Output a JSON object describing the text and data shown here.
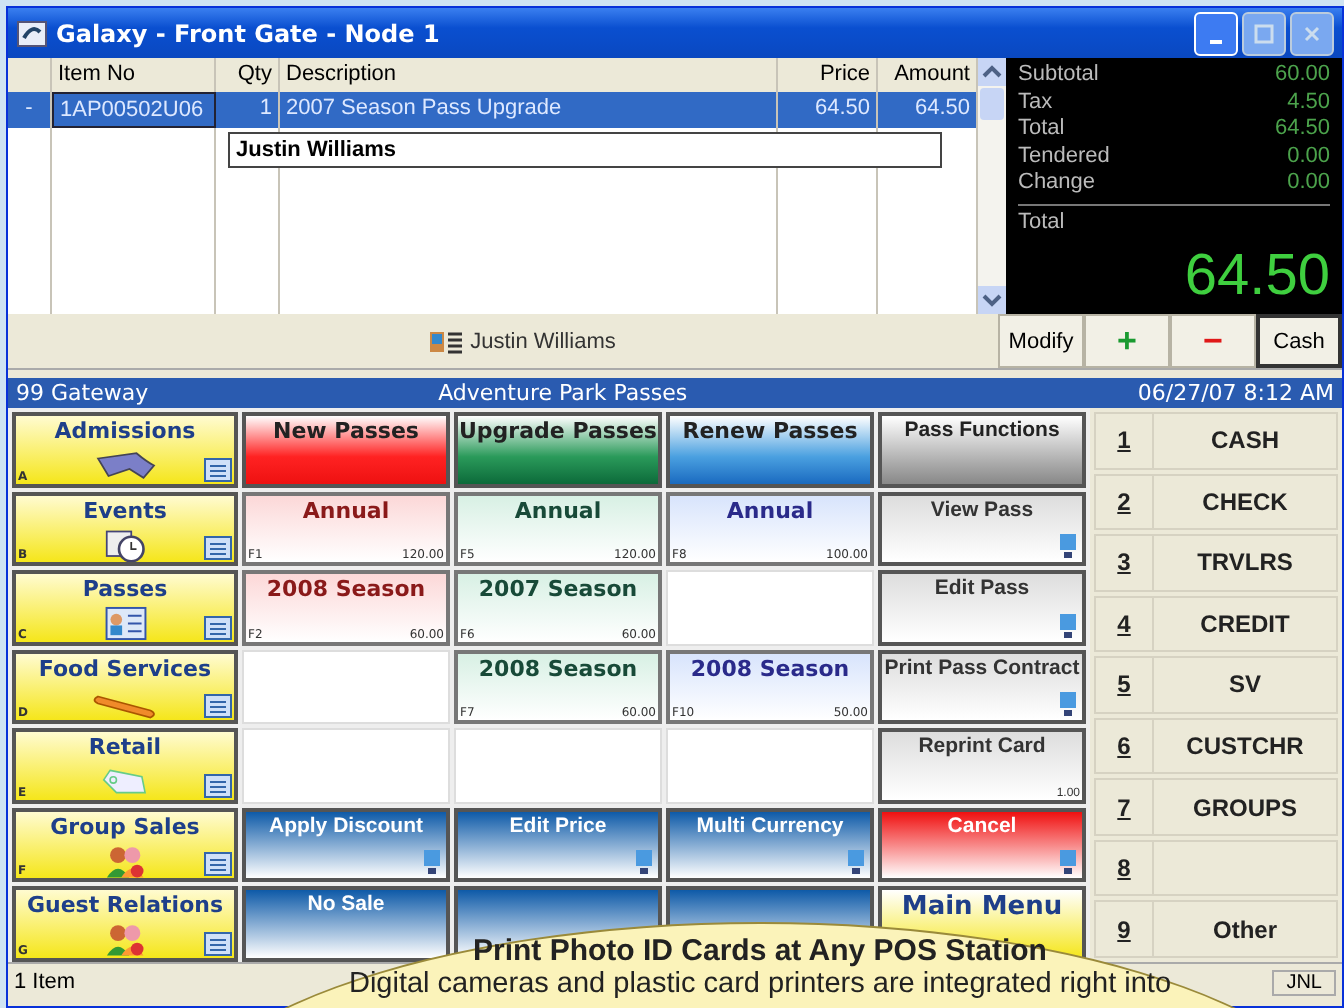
{
  "window": {
    "title": "Galaxy - Front Gate - Node 1"
  },
  "order": {
    "columns": [
      "Item No",
      "Qty",
      "Description",
      "Price",
      "Amount"
    ],
    "rows": [
      {
        "marker": "-",
        "item_no": "1AP00502U06",
        "qty": "1",
        "description": "2007 Season Pass Upgrade",
        "price": "64.50",
        "amount": "64.50",
        "selected": true
      }
    ],
    "note": "Justin Williams"
  },
  "totals": {
    "lines": [
      {
        "label": "Subtotal",
        "value": "60.00"
      },
      {
        "label": "Tax",
        "value": "4.50"
      },
      {
        "label": "Total",
        "value": "64.50"
      },
      {
        "label": "Tendered",
        "value": "0.00"
      },
      {
        "label": "Change",
        "value": "0.00"
      }
    ],
    "grand_label": "Total",
    "grand_value": "64.50"
  },
  "customer": "Justin Williams",
  "actions": [
    "Modify",
    "+",
    "−",
    "Cash"
  ],
  "band": {
    "left": "99 Gateway",
    "center": "Adventure Park Passes",
    "right": "06/27/07  8:12 AM"
  },
  "categories": [
    {
      "label": "Admissions",
      "key": "A"
    },
    {
      "label": "Events",
      "key": "B"
    },
    {
      "label": "Passes",
      "key": "C"
    },
    {
      "label": "Food Services",
      "key": "D"
    },
    {
      "label": "Retail",
      "key": "E"
    },
    {
      "label": "Group Sales",
      "key": "F"
    },
    {
      "label": "Guest Relations",
      "key": "G"
    }
  ],
  "buttons": [
    [
      {
        "kind": "head-red",
        "label": "New Passes"
      },
      {
        "kind": "head-green",
        "label": "Upgrade Passes"
      },
      {
        "kind": "head-blue",
        "label": "Renew Passes"
      },
      {
        "kind": "head-gray",
        "label": "Pass Functions"
      }
    ],
    [
      {
        "kind": "price-red",
        "label": "Annual",
        "fkey": "F1",
        "price": "120.00"
      },
      {
        "kind": "price-green",
        "label": "Annual",
        "fkey": "F5",
        "price": "120.00"
      },
      {
        "kind": "price-blue",
        "label": "Annual",
        "fkey": "F8",
        "price": "100.00"
      },
      {
        "kind": "action-gray",
        "label": "View Pass",
        "remote": true
      }
    ],
    [
      {
        "kind": "price-red",
        "label": "2008 Season",
        "fkey": "F2",
        "price": "60.00"
      },
      {
        "kind": "price-green",
        "label": "2007 Season",
        "fkey": "F6",
        "price": "60.00"
      },
      {
        "kind": "empty"
      },
      {
        "kind": "action-gray",
        "label": "Edit Pass",
        "remote": true
      }
    ],
    [
      {
        "kind": "empty"
      },
      {
        "kind": "price-green",
        "label": "2008 Season",
        "fkey": "F7",
        "price": "60.00"
      },
      {
        "kind": "price-blue",
        "label": "2008 Season",
        "fkey": "F10",
        "price": "50.00"
      },
      {
        "kind": "action-gray",
        "label": "Print Pass Contract",
        "remote": true
      }
    ],
    [
      {
        "kind": "empty"
      },
      {
        "kind": "empty"
      },
      {
        "kind": "empty"
      },
      {
        "kind": "action-gray",
        "label": "Reprint Card",
        "price": "1.00",
        "remote": false
      }
    ],
    [
      {
        "kind": "action-blue",
        "label": "Apply Discount",
        "remote": true
      },
      {
        "kind": "action-blue",
        "label": "Edit Price",
        "remote": true
      },
      {
        "kind": "action-blue",
        "label": "Multi Currency",
        "remote": true
      },
      {
        "kind": "action-red",
        "label": "Cancel",
        "remote": true
      }
    ],
    [
      {
        "kind": "action-blue",
        "label": "No Sale"
      },
      {
        "kind": "action-blue"
      },
      {
        "kind": "action-blue"
      },
      {
        "kind": "menu-yellow",
        "label": "Main Menu"
      }
    ]
  ],
  "tenders": [
    {
      "key": "1",
      "label": "CASH"
    },
    {
      "key": "2",
      "label": "CHECK"
    },
    {
      "key": "3",
      "label": "TRVLRS"
    },
    {
      "key": "4",
      "label": "CREDIT"
    },
    {
      "key": "5",
      "label": "SV"
    },
    {
      "key": "6",
      "label": "CUSTCHR"
    },
    {
      "key": "7",
      "label": "GROUPS"
    },
    {
      "key": "8"
    },
    {
      "key": "9",
      "label": "Other"
    }
  ],
  "status_bar": {
    "left": "1 Item",
    "right": "JNL"
  },
  "callout": {
    "title": "Print Photo ID Cards at Any POS Station",
    "text": "Digital cameras and plastic card printers are integrated right into"
  }
}
